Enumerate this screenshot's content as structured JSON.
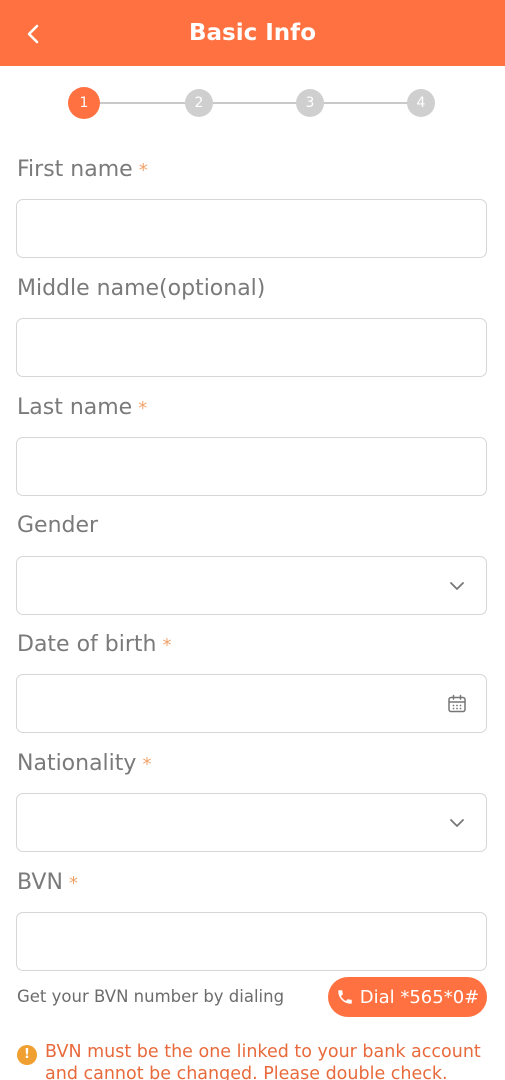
{
  "header": {
    "title": "Basic Info"
  },
  "stepper": {
    "steps": [
      "1",
      "2",
      "3",
      "4"
    ],
    "active_step": 1
  },
  "form": {
    "required_mark": "*",
    "fields": [
      {
        "label": "First name",
        "required": true,
        "type": "text",
        "value": ""
      },
      {
        "label": "Middle name(optional)",
        "required": false,
        "type": "text",
        "value": ""
      },
      {
        "label": "Last name",
        "required": true,
        "type": "text",
        "value": ""
      },
      {
        "label": "Gender",
        "required": false,
        "type": "select",
        "value": ""
      },
      {
        "label": "Date of birth",
        "required": true,
        "type": "date",
        "value": ""
      },
      {
        "label": "Nationality",
        "required": true,
        "type": "select",
        "value": ""
      },
      {
        "label": "BVN",
        "required": true,
        "type": "text",
        "value": ""
      }
    ]
  },
  "bvn_help": {
    "hint": "Get your BVN number by dialing",
    "dial_label": "Dial *565*0#"
  },
  "warning": {
    "icon": "!",
    "text": "BVN must be the one linked to your bank account and cannot be changed. Please double check."
  },
  "colors": {
    "accent": "#FF7140",
    "required": "#F0A36B",
    "warning_text": "#E86A3C",
    "inactive_step": "#cfcfcf"
  }
}
